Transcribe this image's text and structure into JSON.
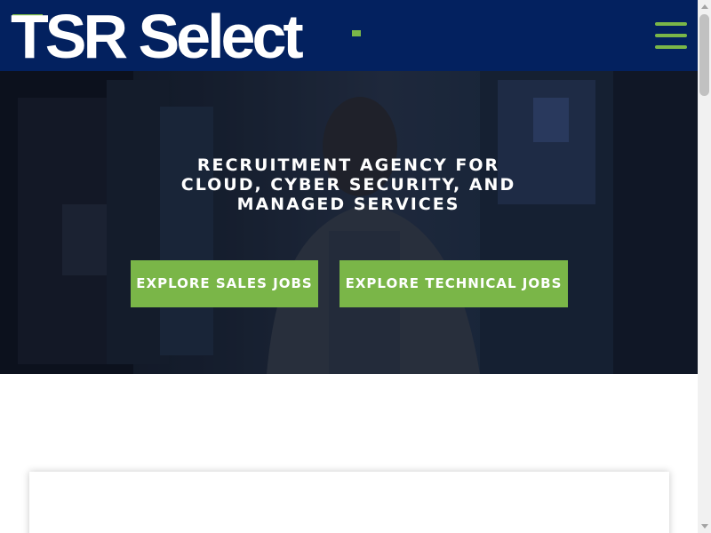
{
  "header": {
    "logo_text": "TSR Select",
    "menu_icon": "hamburger-menu-icon",
    "background_color": "#03215f",
    "accent_color": "#7ab648"
  },
  "hero": {
    "title": "RECRUITMENT AGENCY FOR CLOUD, CYBER SECURITY, AND MANAGED SERVICES",
    "buttons": {
      "sales_label": "EXPLORE SALES JOBS",
      "technical_label": "EXPLORE TECHNICAL JOBS"
    },
    "button_color": "#7ab648"
  },
  "scrollbar": {
    "icon_up": "scroll-up-arrow-icon",
    "icon_down": "scroll-down-arrow-icon"
  }
}
